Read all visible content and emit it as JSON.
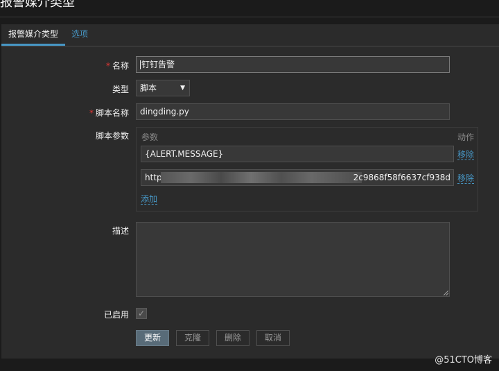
{
  "page": {
    "title": "报警媒介类型"
  },
  "tabs": [
    {
      "label": "报警媒介类型",
      "active": true
    },
    {
      "label": "选项",
      "active": false
    }
  ],
  "form": {
    "name": {
      "label": "名称",
      "required": true,
      "value": "钉钉告警"
    },
    "type": {
      "label": "类型",
      "value": "脚本"
    },
    "script_name": {
      "label": "脚本名称",
      "required": true,
      "value": "dingding.py"
    },
    "script_params": {
      "label": "脚本参数",
      "header_params": "参数",
      "header_actions": "动作",
      "rows": [
        {
          "value": "{ALERT.MESSAGE}",
          "remove_label": "移除"
        },
        {
          "value_prefix": "http",
          "value_suffix": "2c9868f58f6637cf938d",
          "remove_label": "移除"
        }
      ],
      "add_label": "添加"
    },
    "description": {
      "label": "描述",
      "value": ""
    },
    "enabled": {
      "label": "已启用",
      "checked": true
    }
  },
  "buttons": {
    "update": "更新",
    "clone": "克隆",
    "delete": "删除",
    "cancel": "取消"
  },
  "watermark": "@51CTO博客",
  "colors": {
    "link": "#4796c4",
    "required": "#e33734",
    "primary_button": "#586b78"
  }
}
